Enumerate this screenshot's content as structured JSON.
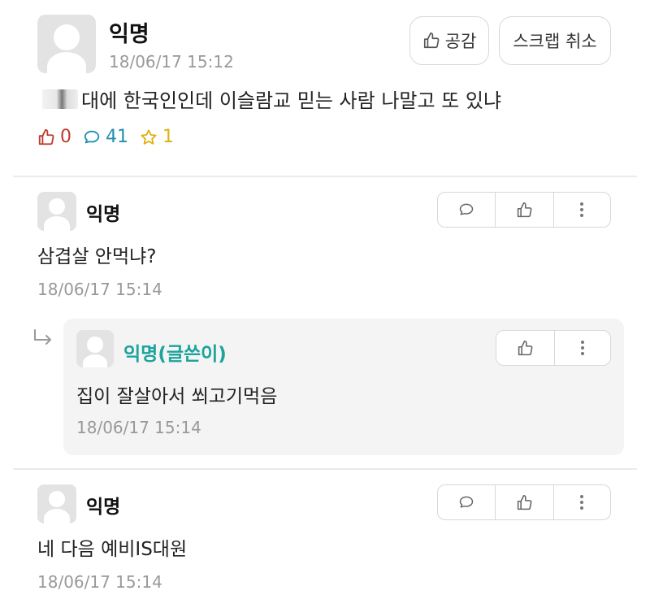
{
  "post": {
    "author": "익명",
    "timestamp": "18/06/17 15:12",
    "like_button_label": "공감",
    "scrap_button_label": "스크랩 취소",
    "content": "대에 한국인인데 이슬람교 믿는 사람 나말고 또 있냐",
    "stats": {
      "likes": "0",
      "comments": "41",
      "scraps": "1"
    }
  },
  "comments": [
    {
      "author": "익명",
      "text": "삼겹살 안먹냐?",
      "timestamp": "18/06/17 15:14",
      "reply": {
        "author": "익명(글쓴이)",
        "text": "집이 잘살아서 쐬고기먹음",
        "timestamp": "18/06/17 15:14"
      }
    },
    {
      "author": "익명",
      "text": "네 다음 예비IS대원",
      "timestamp": "18/06/17 15:14"
    }
  ],
  "colors": {
    "like": "#c0392b",
    "comment": "#1f8fb0",
    "star": "#e0b010",
    "op_author": "#1ba39c",
    "timestamp": "#999999"
  },
  "icons": [
    "thumbs-up-icon",
    "speech-bubble-icon",
    "star-icon",
    "more-vertical-icon",
    "reply-arrow-icon"
  ]
}
